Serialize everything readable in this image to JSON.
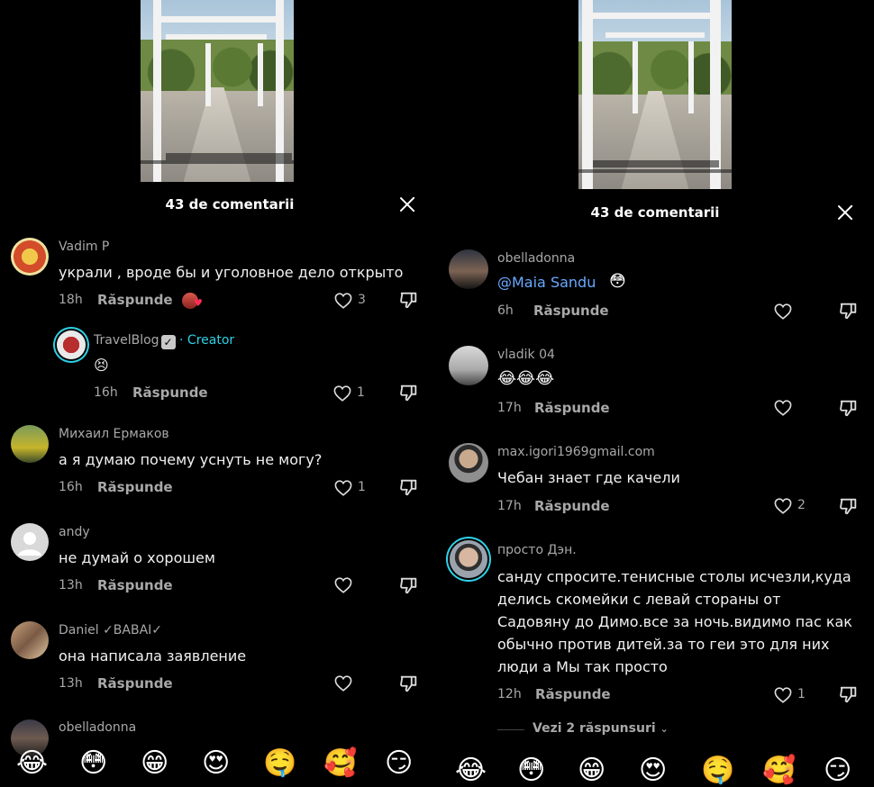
{
  "left": {
    "comments_count": "43 de comentarii",
    "comments": [
      {
        "user": "Vadim P",
        "text": "украли , вроде бы и уголовное дело открыто",
        "time": "18h",
        "reply": "Răspunde",
        "likes": "3"
      },
      {
        "user": "TravelBlog",
        "badge": "✓",
        "creator": "· Creator",
        "text": "😣",
        "time": "16h",
        "reply": "Răspunde",
        "likes": "1"
      },
      {
        "user": "Михаил Ермаков",
        "text": "а я думаю почему уснуть не могу?",
        "time": "16h",
        "reply": "Răspunde",
        "likes": "1"
      },
      {
        "user": "andy",
        "text": "не думай о хорошем",
        "time": "13h",
        "reply": "Răspunde",
        "likes": ""
      },
      {
        "user": "Daniel ✓BABAI✓",
        "text": "она написала заявление",
        "time": "13h",
        "reply": "Răspunde",
        "likes": ""
      },
      {
        "user": "obelladonna"
      }
    ],
    "emojis": [
      "😂",
      "😳",
      "😁",
      "😍",
      "🤤",
      "🥰",
      "😏"
    ]
  },
  "right": {
    "comments_count": "43 de comentarii",
    "comments": [
      {
        "user": "obelladonna",
        "text": "@Maia Sandu",
        "emoji": "😳",
        "time": "6h",
        "reply": "Răspunde",
        "likes": ""
      },
      {
        "user": "vladik 04",
        "text": "😂😂😂",
        "time": "17h",
        "reply": "Răspunde",
        "likes": ""
      },
      {
        "user": "max.igori1969gmail.com",
        "text": "Чебан знает где качели",
        "time": "17h",
        "reply": "Răspunde",
        "likes": "2"
      },
      {
        "user": "просто Дэн.",
        "text_lines": [
          "санду спросите.тенисные столы исчезли,куда",
          "делись скомейки с левай стораны от",
          "Садовяну до Димо.все за ночь.видимо пас как",
          "обычно против дитей.за то геи это для них",
          "люди а Мы так просто"
        ],
        "time": "12h",
        "reply": "Răspunde",
        "likes": "1"
      }
    ],
    "view_replies": "Vezi 2 răspunsuri",
    "emojis": [
      "😂",
      "😳",
      "😁",
      "😍",
      "🤤",
      "🥰",
      "😏"
    ]
  },
  "colors": {
    "background": "#000000",
    "secondary_text": "#a8a8a8",
    "creator": "#2fd1e6",
    "mention": "#69a9ff",
    "story_ring": "#2fd1e6"
  },
  "icons": [
    "heart-outline-icon",
    "dislike-icon",
    "close-icon",
    "verified-badge-icon",
    "chevron-down-icon"
  ]
}
